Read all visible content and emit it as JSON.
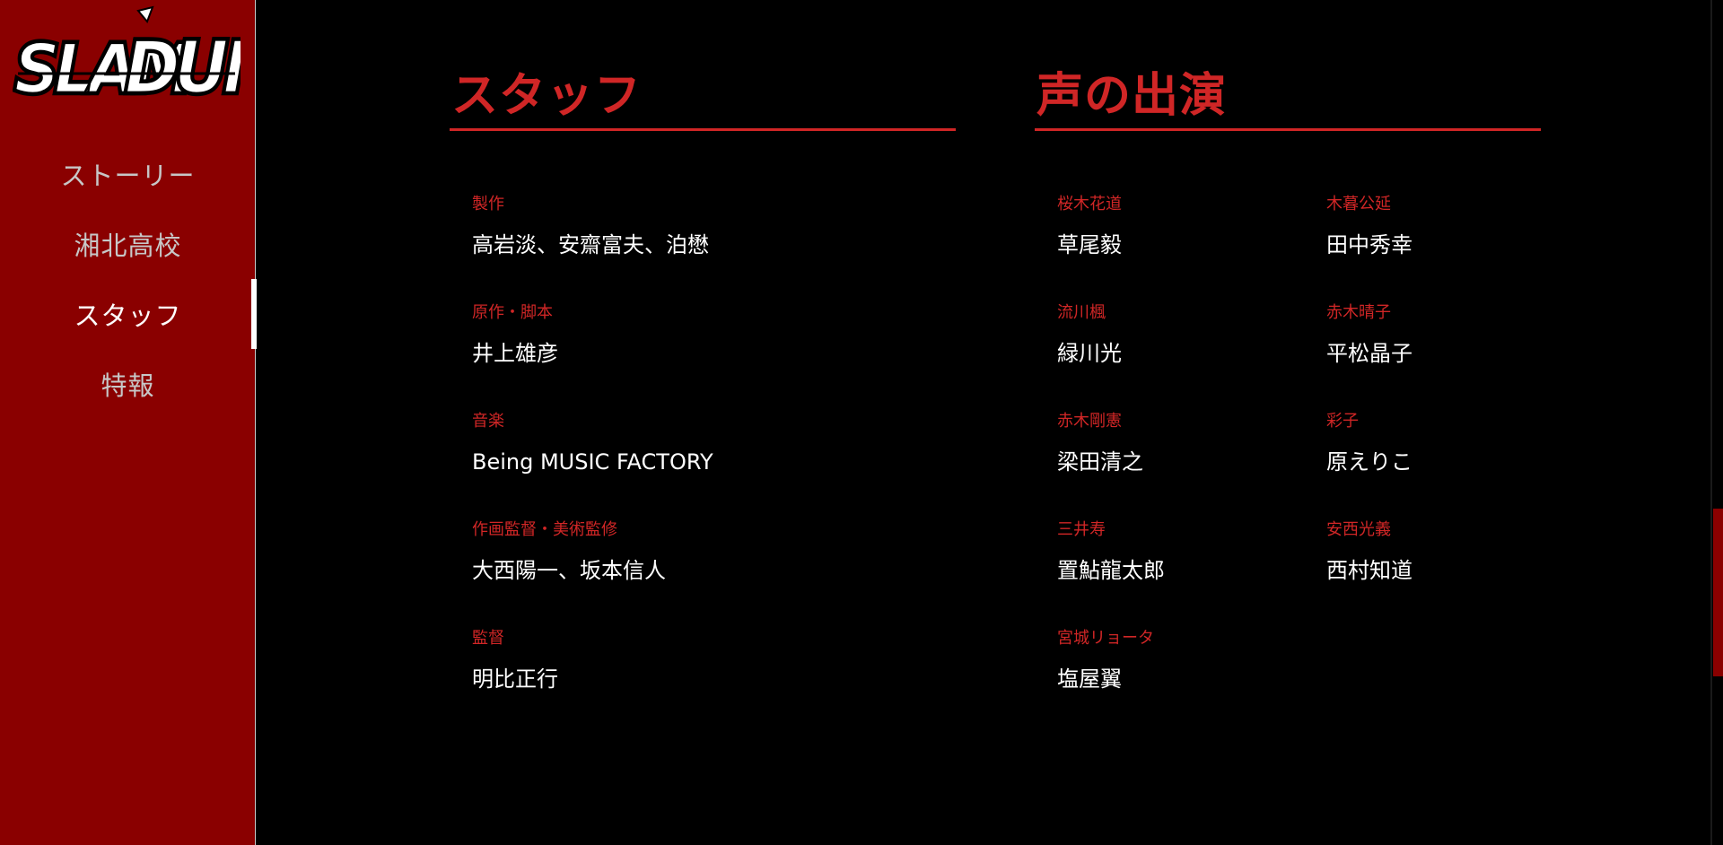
{
  "logo": {
    "text": "SLAM DUNK"
  },
  "nav": {
    "items": [
      {
        "label": "ストーリー"
      },
      {
        "label": "湘北高校"
      },
      {
        "label": "スタッフ",
        "active": true
      },
      {
        "label": "特報"
      }
    ]
  },
  "staff": {
    "title": "スタッフ",
    "credits": [
      {
        "role": "製作",
        "name": "高岩淡、安齋富夫、泊懋"
      },
      {
        "role": "原作・脚本",
        "name": "井上雄彦"
      },
      {
        "role": "音楽",
        "name": "Being MUSIC FACTORY"
      },
      {
        "role": "作画監督・美術監修",
        "name": "大西陽一、坂本信人"
      },
      {
        "role": "監督",
        "name": "明比正行"
      }
    ]
  },
  "cast": {
    "title": "声の出演",
    "credits": [
      {
        "role": "桜木花道",
        "name": "草尾毅"
      },
      {
        "role": "木暮公延",
        "name": "田中秀幸"
      },
      {
        "role": "流川楓",
        "name": "緑川光"
      },
      {
        "role": "赤木晴子",
        "name": "平松晶子"
      },
      {
        "role": "赤木剛憲",
        "name": "梁田清之"
      },
      {
        "role": "彩子",
        "name": "原えりこ"
      },
      {
        "role": "三井寿",
        "name": "置鮎龍太郎"
      },
      {
        "role": "安西光義",
        "name": "西村知道"
      },
      {
        "role": "宮城リョータ",
        "name": "塩屋翼"
      }
    ]
  },
  "scrollbar": {
    "position_fraction": 0.78
  },
  "colors": {
    "sidebar_bg": "#8a0000",
    "accent_red": "#d02626",
    "background": "#000000",
    "text": "#ffffff",
    "nav_inactive": "#c7c7c7"
  }
}
